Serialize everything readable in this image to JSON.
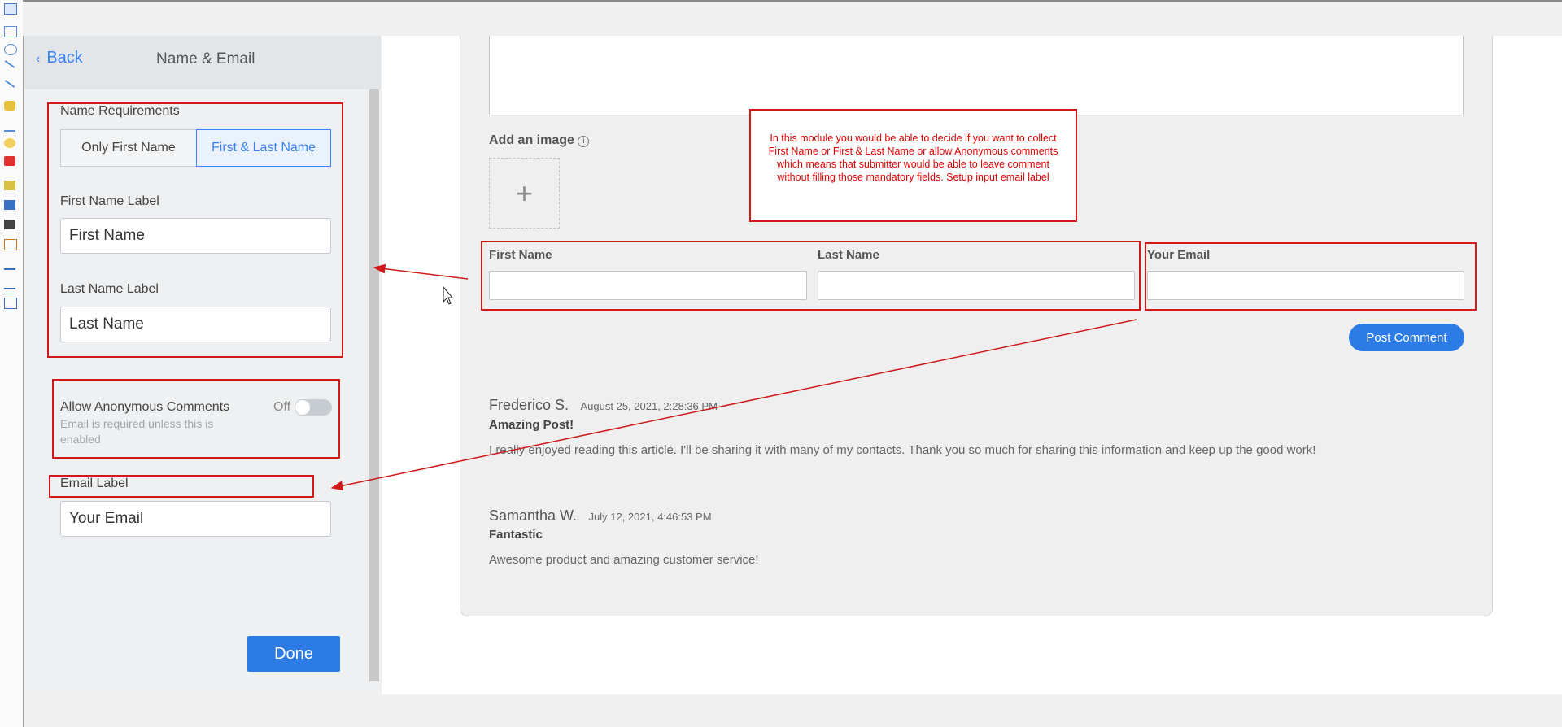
{
  "panel": {
    "back_label": "Back",
    "title": "Name & Email",
    "name_requirements_label": "Name Requirements",
    "options": [
      "Only First Name",
      "First & Last Name"
    ],
    "selected_option": "First & Last Name",
    "first_name_label": "First Name Label",
    "first_name_value": "First Name",
    "last_name_label": "Last Name Label",
    "last_name_value": "Last Name",
    "anonymous_label": "Allow Anonymous Comments",
    "anonymous_state": "Off",
    "anonymous_help": "Email is required unless this is enabled",
    "email_label": "Email Label",
    "email_value": "Your Email",
    "done_label": "Done"
  },
  "main": {
    "add_image_label": "Add an image",
    "add_image_icon": "info-icon",
    "form": {
      "first_name": "First Name",
      "last_name": "Last Name",
      "email": "Your Email"
    },
    "post_button": "Post Comment",
    "comments": [
      {
        "author": "Frederico S.",
        "date": "August 25, 2021, 2:28:36 PM",
        "title": "Amazing Post!",
        "body": "I really enjoyed reading this article. I'll be sharing it with many of my contacts. Thank you so much for sharing this information and keep up the good work!"
      },
      {
        "author": "Samantha W.",
        "date": "July 12, 2021, 4:46:53 PM",
        "title": "Fantastic",
        "body": "Awesome product and amazing customer service!"
      }
    ]
  },
  "annotation": {
    "note": "In this module you would be able to decide if you want to collect First Name or First & Last Name or allow Anonymous comments which means that submitter would be able to leave comment without filling those mandatory fields. Setup input email label",
    "color": "#d01a1a"
  },
  "colors": {
    "accent": "#2d7be5"
  }
}
